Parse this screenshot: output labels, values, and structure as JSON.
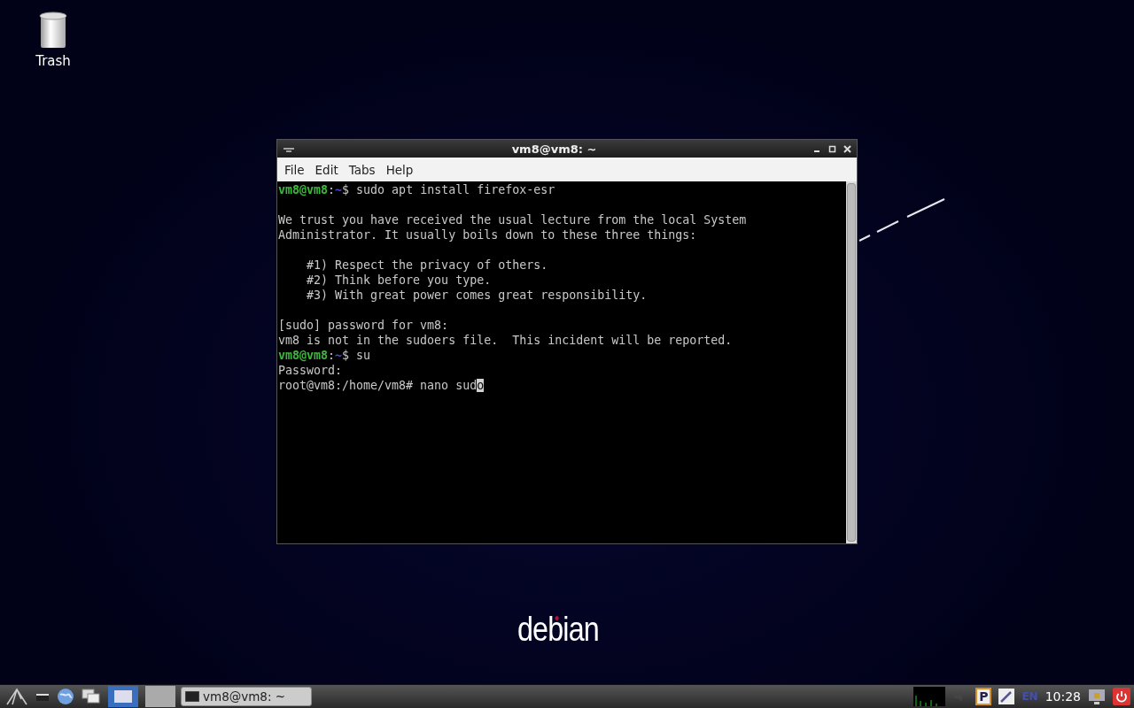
{
  "desktop_icons": [
    {
      "label": "Trash"
    }
  ],
  "terminal": {
    "title": "vm8@vm8: ~",
    "menu": [
      "File",
      "Edit",
      "Tabs",
      "Help"
    ],
    "blocks": [
      {
        "lines": [
          {
            "segments": [
              {
                "kind": "user",
                "text": "vm8@vm8"
              },
              {
                "kind": "plain",
                "text": ":"
              },
              {
                "kind": "dir",
                "text": "~"
              },
              {
                "kind": "plain",
                "text": "$ sudo apt install firefox-esr"
              }
            ]
          }
        ]
      },
      {
        "lines": [
          {
            "segments": [
              {
                "kind": "plain",
                "text": "We trust you have received the usual lecture from the local System"
              }
            ]
          },
          {
            "segments": [
              {
                "kind": "plain",
                "text": "Administrator. It usually boils down to these three things:"
              }
            ]
          }
        ]
      },
      {
        "lines": [
          {
            "segments": [
              {
                "kind": "plain",
                "text": "    #1) Respect the privacy of others."
              }
            ]
          },
          {
            "segments": [
              {
                "kind": "plain",
                "text": "    #2) Think before you type."
              }
            ]
          },
          {
            "segments": [
              {
                "kind": "plain",
                "text": "    #3) With great power comes great responsibility."
              }
            ]
          }
        ]
      },
      {
        "lines": [
          {
            "segments": [
              {
                "kind": "plain",
                "text": "[sudo] password for vm8:"
              }
            ]
          },
          {
            "segments": [
              {
                "kind": "plain",
                "text": "vm8 is not in the sudoers file.  This incident will be reported."
              }
            ]
          },
          {
            "segments": [
              {
                "kind": "user",
                "text": "vm8@vm8"
              },
              {
                "kind": "plain",
                "text": ":"
              },
              {
                "kind": "dir",
                "text": "~"
              },
              {
                "kind": "plain",
                "text": "$ su"
              }
            ]
          },
          {
            "segments": [
              {
                "kind": "plain",
                "text": "Password:"
              }
            ]
          },
          {
            "segments": [
              {
                "kind": "plain",
                "text": "root@vm8:/home/vm8# nano sud"
              },
              {
                "kind": "cursor",
                "text": "o"
              }
            ]
          }
        ]
      }
    ]
  },
  "logo": {
    "text": "debian"
  },
  "taskbar": {
    "tasks": [
      {
        "label": "vm8@vm8: ~",
        "selected": false
      }
    ],
    "tray": {
      "clipboard": "P",
      "keyboard_layout": "EN",
      "clock": "10:28"
    }
  }
}
